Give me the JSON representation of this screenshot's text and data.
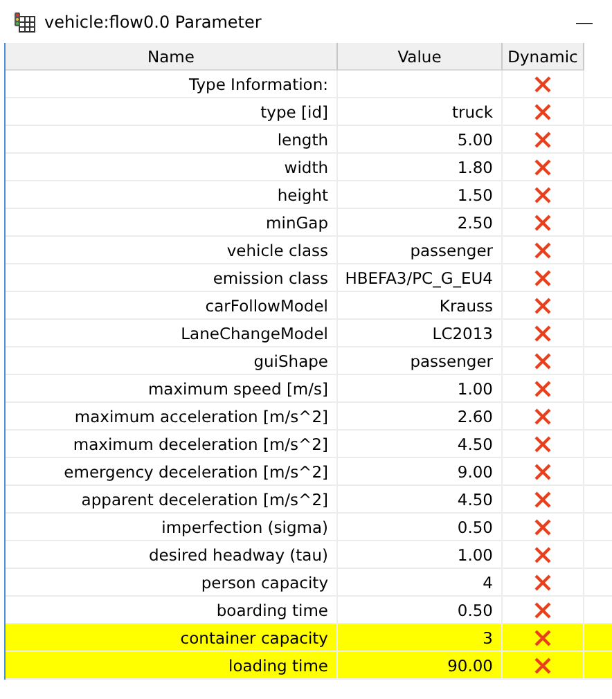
{
  "window": {
    "title": "vehicle:flow0.0 Parameter",
    "minimize": "—"
  },
  "table": {
    "columns": [
      "Name",
      "Value",
      "Dynamic"
    ],
    "rows": [
      {
        "name": "Type Information:",
        "value": "",
        "dynamic": false,
        "highlighted": false
      },
      {
        "name": "type [id]",
        "value": "truck",
        "dynamic": false,
        "highlighted": false
      },
      {
        "name": "length",
        "value": "5.00",
        "dynamic": false,
        "highlighted": false
      },
      {
        "name": "width",
        "value": "1.80",
        "dynamic": false,
        "highlighted": false
      },
      {
        "name": "height",
        "value": "1.50",
        "dynamic": false,
        "highlighted": false
      },
      {
        "name": "minGap",
        "value": "2.50",
        "dynamic": false,
        "highlighted": false
      },
      {
        "name": "vehicle class",
        "value": "passenger",
        "dynamic": false,
        "highlighted": false
      },
      {
        "name": "emission class",
        "value": "HBEFA3/PC_G_EU4",
        "dynamic": false,
        "highlighted": false
      },
      {
        "name": "carFollowModel",
        "value": "Krauss",
        "dynamic": false,
        "highlighted": false
      },
      {
        "name": "LaneChangeModel",
        "value": "LC2013",
        "dynamic": false,
        "highlighted": false
      },
      {
        "name": "guiShape",
        "value": "passenger",
        "dynamic": false,
        "highlighted": false
      },
      {
        "name": "maximum speed [m/s]",
        "value": "1.00",
        "dynamic": false,
        "highlighted": false
      },
      {
        "name": "maximum acceleration [m/s^2]",
        "value": "2.60",
        "dynamic": false,
        "highlighted": false
      },
      {
        "name": "maximum deceleration [m/s^2]",
        "value": "4.50",
        "dynamic": false,
        "highlighted": false
      },
      {
        "name": "emergency deceleration [m/s^2]",
        "value": "9.00",
        "dynamic": false,
        "highlighted": false
      },
      {
        "name": "apparent deceleration [m/s^2]",
        "value": "4.50",
        "dynamic": false,
        "highlighted": false
      },
      {
        "name": "imperfection (sigma)",
        "value": "0.50",
        "dynamic": false,
        "highlighted": false
      },
      {
        "name": "desired headway (tau)",
        "value": "1.00",
        "dynamic": false,
        "highlighted": false
      },
      {
        "name": "person capacity",
        "value": "4",
        "dynamic": false,
        "highlighted": false
      },
      {
        "name": "boarding time",
        "value": "0.50",
        "dynamic": false,
        "highlighted": false
      },
      {
        "name": "container capacity",
        "value": "3",
        "dynamic": false,
        "highlighted": true
      },
      {
        "name": "loading time",
        "value": "90.00",
        "dynamic": false,
        "highlighted": true
      }
    ]
  }
}
